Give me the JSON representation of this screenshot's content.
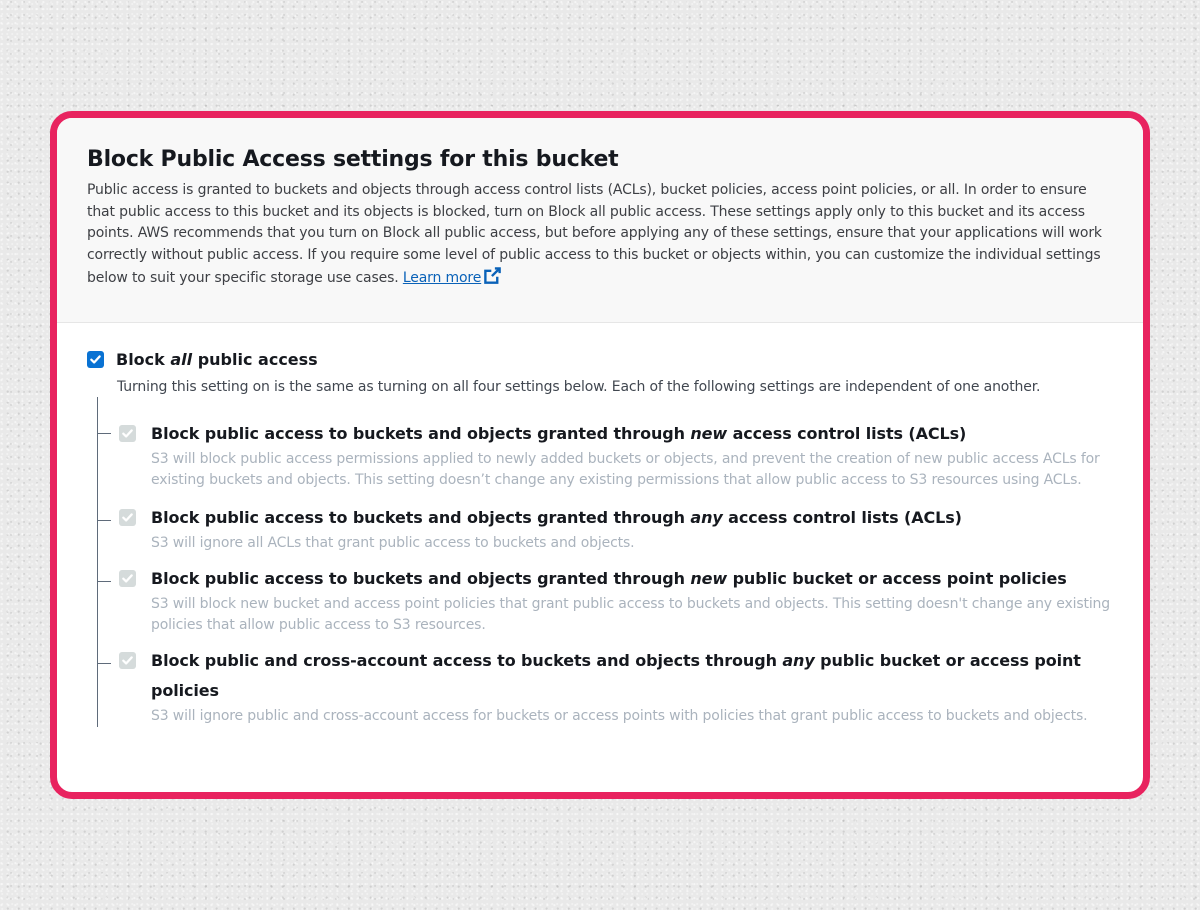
{
  "header": {
    "title": "Block Public Access settings for this bucket",
    "description": "Public access is granted to buckets and objects through access control lists (ACLs), bucket policies, access point policies, or all. In order to ensure that public access to this bucket and its objects is blocked, turn on Block all public access. These settings apply only to this bucket and its access points. AWS recommends that you turn on Block all public access, but before applying any of these settings, ensure that your applications will work correctly without public access. If you require some level of public access to this bucket or objects within, you can customize the individual settings below to suit your specific storage use cases.",
    "learn_more": "Learn more",
    "learn_more_icon": "external-link-icon"
  },
  "master": {
    "checked": true,
    "label_before": "Block ",
    "label_emphasis": "all",
    "label_after": " public access",
    "description": "Turning this setting on is the same as turning on all four settings below. Each of the following settings are independent of one another."
  },
  "options": [
    {
      "checked": true,
      "disabled": true,
      "label_before": "Block public access to buckets and objects granted through ",
      "label_emphasis": "new",
      "label_after": " access control lists (ACLs)",
      "description": "S3 will block public access permissions applied to newly added buckets or objects, and prevent the creation of new public access ACLs for existing buckets and objects. This setting doesn’t change any existing permissions that allow public access to S3 resources using ACLs."
    },
    {
      "checked": true,
      "disabled": true,
      "label_before": "Block public access to buckets and objects granted through ",
      "label_emphasis": "any",
      "label_after": " access control lists (ACLs)",
      "description": "S3 will ignore all ACLs that grant public access to buckets and objects."
    },
    {
      "checked": true,
      "disabled": true,
      "label_before": "Block public access to buckets and objects granted through ",
      "label_emphasis": "new",
      "label_after": " public bucket or access point policies",
      "description": "S3 will block new bucket and access point policies that grant public access to buckets and objects. This setting doesn't change any existing policies that allow public access to S3 resources."
    },
    {
      "checked": true,
      "disabled": true,
      "label_before": "Block public and cross-account access to buckets and objects through ",
      "label_emphasis": "any",
      "label_after": " public bucket or access point policies",
      "description": "S3 will ignore public and cross-account access for buckets or access points with policies that grant public access to buckets and objects."
    }
  ],
  "colors": {
    "frame": "#e8235f",
    "checkbox_active": "#0972d3",
    "checkbox_disabled": "#d5dbdb",
    "link": "#0a62b8",
    "muted_text": "#aab3bd"
  }
}
